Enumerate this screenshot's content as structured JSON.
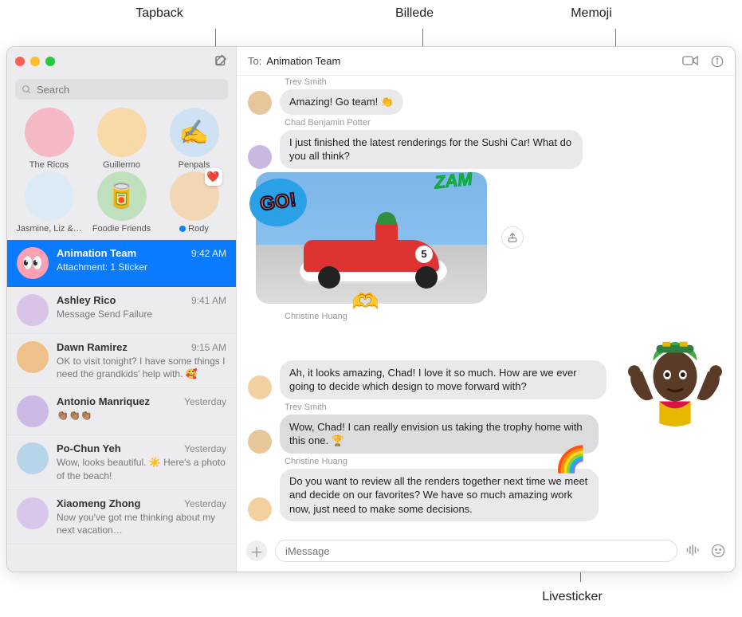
{
  "callouts": {
    "tapback": "Tapback",
    "billede": "Billede",
    "memoji": "Memoji",
    "livesticker": "Livesticker"
  },
  "search": {
    "placeholder": "Search"
  },
  "pins": [
    {
      "label": "The Ricos",
      "bg": "#f4b9c5"
    },
    {
      "label": "Guillermo",
      "bg": "#f8d9a8"
    },
    {
      "label": "Penpals",
      "bg": "#cfe2f3",
      "emoji": "✍️"
    },
    {
      "label": "Jasmine, Liz &…",
      "bg": "#dbeaf5"
    },
    {
      "label": "Foodie Friends",
      "bg": "#bfe0bd",
      "emoji": "🥫"
    },
    {
      "label": "Rody",
      "bg": "#f3d7b5",
      "status": true,
      "heart": true
    }
  ],
  "conversations": [
    {
      "name": "Animation Team",
      "time": "9:42 AM",
      "preview": "Attachment: 1 Sticker",
      "selected": true,
      "avatar_emoji": "👀",
      "avatar_bg": "#ff9fb1"
    },
    {
      "name": "Ashley Rico",
      "time": "9:41 AM",
      "preview": "Message Send Failure",
      "avatar_bg": "#d9c3e6"
    },
    {
      "name": "Dawn Ramirez",
      "time": "9:15 AM",
      "preview": "OK to visit tonight? I have some things I need the grandkids' help with. 🥰",
      "avatar_bg": "#f0c08a"
    },
    {
      "name": "Antonio Manriquez",
      "time": "Yesterday",
      "preview": "👏🏽👏🏽👏🏽",
      "avatar_bg": "#cdb9e6"
    },
    {
      "name": "Po-Chun Yeh",
      "time": "Yesterday",
      "preview": "Wow, looks beautiful. ☀️ Here's a photo of the beach!",
      "avatar_bg": "#b6d5ea"
    },
    {
      "name": "Xiaomeng Zhong",
      "time": "Yesterday",
      "preview": "Now you've got me thinking about my next vacation…",
      "avatar_bg": "#d8c7ea"
    }
  ],
  "header": {
    "to_label": "To:",
    "recipient": "Animation Team"
  },
  "messages": {
    "m1_sender": "Trev Smith",
    "m1_text": "Amazing! Go team! 👏",
    "m2_sender": "Chad Benjamin Potter",
    "m2_text": "I just finished the latest renderings for the Sushi Car! What do you all think?",
    "go_sticker": "GO!",
    "zam_sticker": "ZAM",
    "car_number": "5",
    "m3_sender": "Christine Huang",
    "m3_text": "Ah, it looks amazing, Chad! I love it so much. How are we ever going to decide which design to move forward with?",
    "m4_sender": "Trev Smith",
    "m4_text": "Wow, Chad! I can really envision us taking the trophy home with this one. 🏆",
    "m5_sender": "Christine Huang",
    "m5_text": "Do you want to review all the renders together next time we meet and decide on our favorites? We have so much amazing work now, just need to make some decisions."
  },
  "composer": {
    "placeholder": "iMessage"
  }
}
